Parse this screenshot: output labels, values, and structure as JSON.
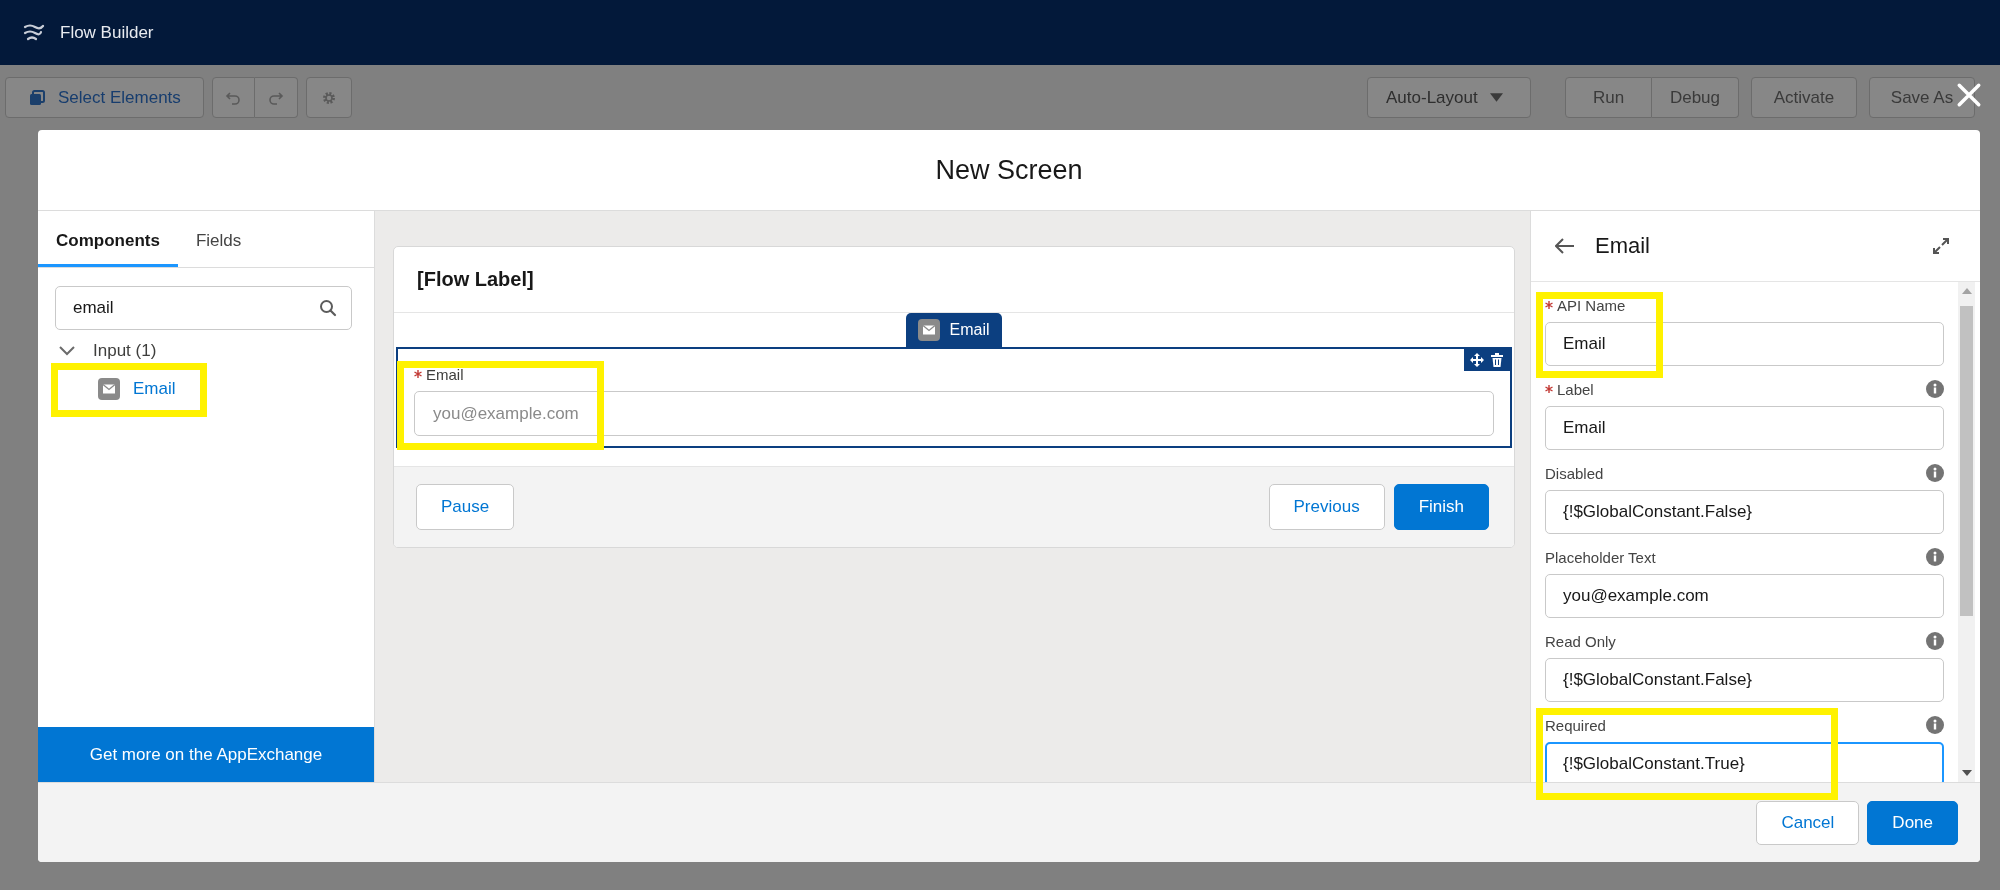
{
  "app_bar": {
    "title": "Flow Builder"
  },
  "toolbar": {
    "select_button": "Select Elements",
    "layout_dropdown": "Auto-Layout",
    "actions": [
      {
        "label": "Run",
        "disabled": true
      },
      {
        "label": "Debug",
        "disabled": true
      },
      {
        "label": "Activate",
        "disabled": true
      },
      {
        "label": "Save As",
        "disabled": true
      }
    ]
  },
  "modal": {
    "title": "New Screen",
    "left_panel": {
      "tabs": [
        {
          "label": "Components",
          "selected": true
        },
        {
          "label": "Fields",
          "selected": false
        }
      ],
      "search": {
        "value": "email"
      },
      "tree": [
        {
          "label": "Input (1)",
          "expanded": true,
          "children": [
            {
              "label": "Email"
            }
          ]
        }
      ],
      "appexchange_button": "Get more on the AppExchange"
    },
    "canvas": {
      "flow_label": "[Flow Label]",
      "component_tab": "Email",
      "field": {
        "label": "Email",
        "required": true,
        "placeholder": "you@example.com"
      },
      "left_buttons": [
        {
          "label": "Pause",
          "kind": "neutral"
        }
      ],
      "right_buttons": [
        {
          "label": "Previous",
          "kind": "neutral"
        },
        {
          "label": "Finish",
          "kind": "brand"
        }
      ]
    },
    "properties": {
      "title": "Email",
      "fields": [
        {
          "label": "API Name",
          "required": true,
          "info": false,
          "value": "Email",
          "focused": false
        },
        {
          "label": "Label",
          "required": true,
          "info": true,
          "value": "Email",
          "focused": false
        },
        {
          "label": "Disabled",
          "required": false,
          "info": true,
          "value": "{!$GlobalConstant.False}",
          "focused": false
        },
        {
          "label": "Placeholder Text",
          "required": false,
          "info": true,
          "value": "you@example.com",
          "focused": false
        },
        {
          "label": "Read Only",
          "required": false,
          "info": true,
          "value": "{!$GlobalConstant.False}",
          "focused": false
        },
        {
          "label": "Required",
          "required": false,
          "info": true,
          "value": "{!$GlobalConstant.True}",
          "focused": true
        }
      ]
    },
    "footer_buttons": [
      {
        "label": "Cancel",
        "kind": "neutral"
      },
      {
        "label": "Done",
        "kind": "brand"
      }
    ]
  }
}
